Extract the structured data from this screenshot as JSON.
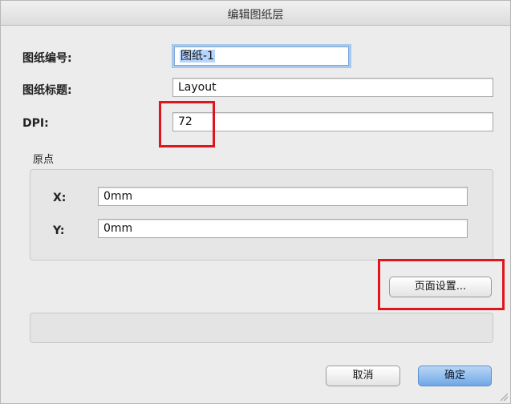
{
  "dialog": {
    "title": "编辑图纸层",
    "fields": {
      "number": {
        "label": "图纸编号:",
        "value": "图纸-1"
      },
      "title": {
        "label": "图纸标题:",
        "value": "Layout"
      },
      "dpi": {
        "label": "DPI:",
        "value": "72"
      }
    },
    "origin": {
      "title": "原点",
      "x": {
        "label": "X:",
        "value": "0mm"
      },
      "y": {
        "label": "Y:",
        "value": "0mm"
      }
    },
    "buttons": {
      "page_setup": "页面设置...",
      "cancel": "取消",
      "ok": "确定"
    }
  },
  "colors": {
    "highlight": "#e0161c",
    "primary_button": "#6fa7e6",
    "focus_ring": "#a8c8ee"
  }
}
